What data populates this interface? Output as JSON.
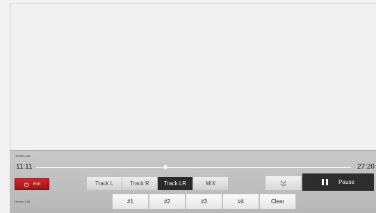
{
  "player": {
    "file_name": "200904.wav",
    "time_current": "11:11",
    "time_total": "27:20",
    "progress": 0.41,
    "version": "Version 2.55"
  },
  "controls": {
    "exit_label": "Exit",
    "track_buttons": [
      {
        "label": "Track L",
        "active": false
      },
      {
        "label": "Track R",
        "active": false
      },
      {
        "label": "Track LR",
        "active": true
      },
      {
        "label": "MIX",
        "active": false
      }
    ],
    "pause_label": "Pause",
    "presets": [
      "#1",
      "#2",
      "#3",
      "#4"
    ],
    "clear_label": "Clear"
  },
  "icons": {
    "exit": "power-icon",
    "expand": "double-chevron-down-icon",
    "pause": "pause-icon"
  },
  "colors": {
    "exit_red": "#c1161d",
    "active_track": "#2a2a2a",
    "pause_bg": "#2d2d2d"
  }
}
